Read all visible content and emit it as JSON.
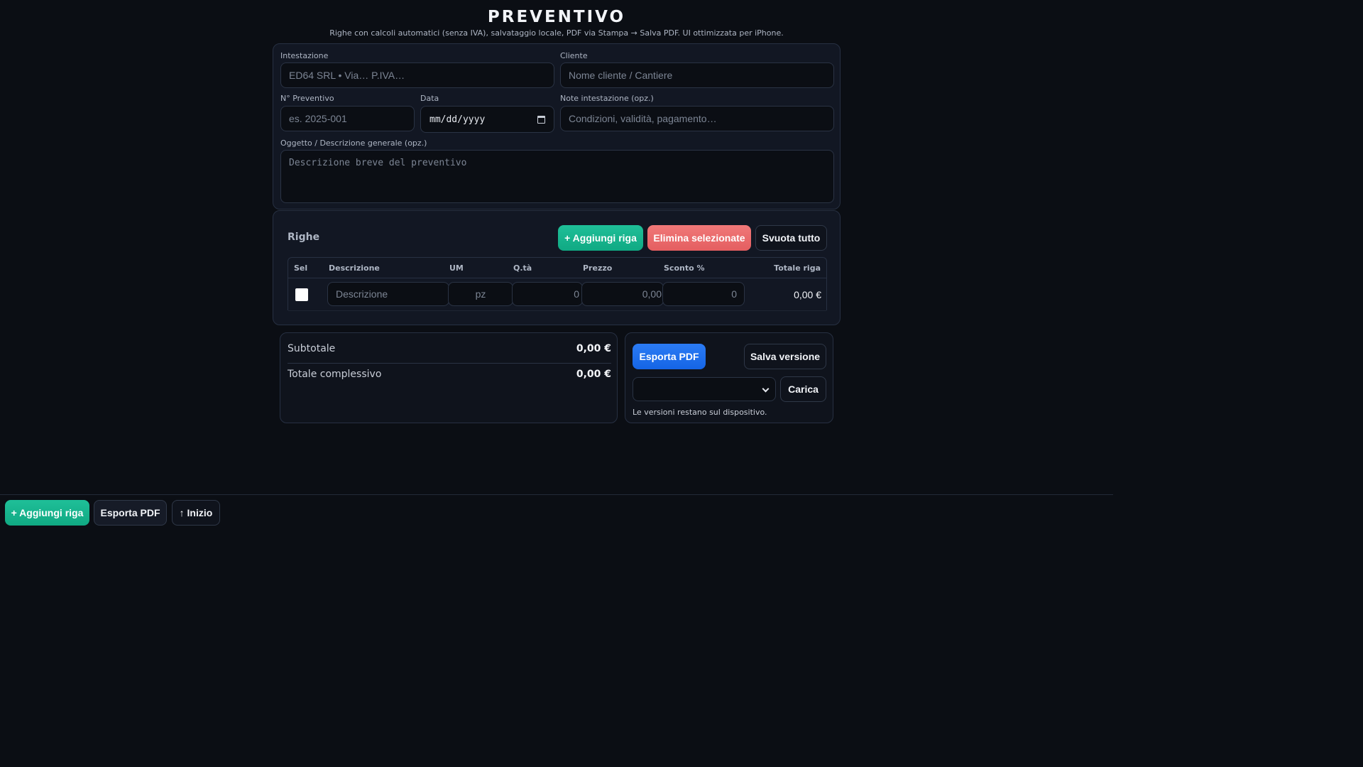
{
  "header": {
    "title": "PREVENTIVO",
    "subtitle": "Righe con calcoli automatici (senza IVA), salvataggio locale, PDF via Stampa → Salva PDF. UI ottimizzata per iPhone."
  },
  "form": {
    "intestazione": {
      "label": "Intestazione",
      "placeholder": "ED64 SRL • Via… P.IVA…",
      "value": ""
    },
    "cliente": {
      "label": "Cliente",
      "placeholder": "Nome cliente / Cantiere",
      "value": ""
    },
    "numero": {
      "label": "N° Preventivo",
      "placeholder": "es. 2025-001",
      "value": ""
    },
    "data": {
      "label": "Data",
      "value": "mm/dd/yyyy"
    },
    "note": {
      "label": "Note intestazione (opz.)",
      "placeholder": "Condizioni, validità, pagamento…",
      "value": ""
    },
    "oggetto": {
      "label": "Oggetto / Descrizione generale (opz.)",
      "placeholder": "Descrizione breve del preventivo",
      "value": ""
    }
  },
  "rows_section": {
    "title": "Righe",
    "add_label": "+ Aggiungi riga",
    "delete_label": "Elimina selezionate",
    "clear_label": "Svuota tutto",
    "columns": [
      "Sel",
      "Descrizione",
      "UM",
      "Q.tà",
      "Prezzo",
      "Sconto %",
      "Totale riga"
    ],
    "rows": [
      {
        "selected": false,
        "descrizione_placeholder": "Descrizione",
        "um_placeholder": "pz",
        "qta_placeholder": "0",
        "prezzo_placeholder": "0,00",
        "sconto_placeholder": "0",
        "totale": "0,00 €"
      }
    ]
  },
  "totals": {
    "subtotale_label": "Subtotale",
    "subtotale_value": "0,00 €",
    "totale_label": "Totale complessivo",
    "totale_value": "0,00 €"
  },
  "versions": {
    "export_label": "Esporta PDF",
    "save_label": "Salva versione",
    "select_value": "",
    "load_label": "Carica",
    "note": "Le versioni restano sul dispositivo."
  },
  "bottom_bar": {
    "add_label": "+ Aggiungi riga",
    "export_label": "Esporta PDF",
    "top_label": "↑ Inizio"
  },
  "colors": {
    "background": "#0b0e14",
    "card": "#121723",
    "green": "#10a983",
    "red": "#e45e60",
    "blue": "#1565e6"
  }
}
